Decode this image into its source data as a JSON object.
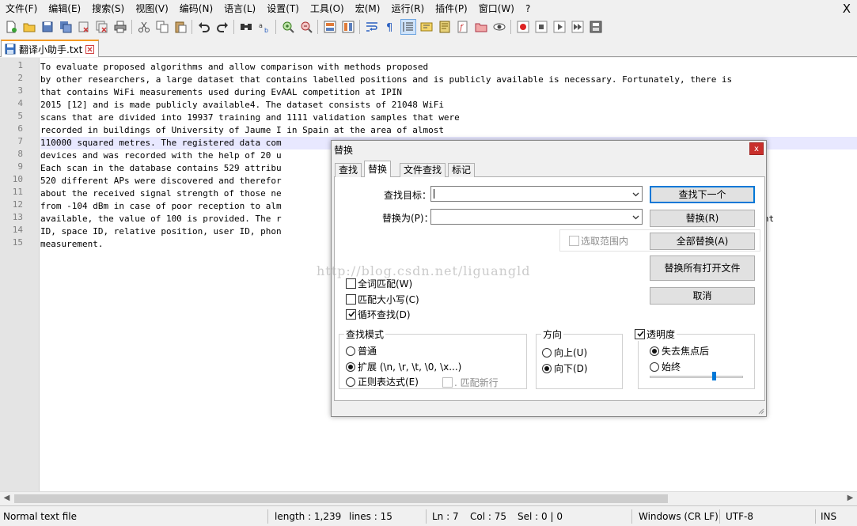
{
  "menu": {
    "items": [
      "文件(F)",
      "编辑(E)",
      "搜索(S)",
      "视图(V)",
      "编码(N)",
      "语言(L)",
      "设置(T)",
      "工具(O)",
      "宏(M)",
      "运行(R)",
      "插件(P)",
      "窗口(W)",
      "?"
    ],
    "close": "X"
  },
  "toolbar_icons": [
    "new-file-icon",
    "open-file-icon",
    "save-icon",
    "save-all-icon",
    "close-icon",
    "close-all-icon",
    "print-icon",
    "cut-icon",
    "copy-icon",
    "paste-icon",
    "undo-icon",
    "redo-icon",
    "find-icon",
    "replace-icon",
    "zoom-in-icon",
    "zoom-out-icon",
    "sync-vertical-icon",
    "sync-horizontal-icon",
    "word-wrap-icon",
    "show-all-chars-icon",
    "indent-guide-icon",
    "user-lang-icon",
    "doc-map-icon",
    "function-list-icon",
    "folder-workspace-icon",
    "monitor-icon",
    "record-macro-icon",
    "stop-macro-icon",
    "play-macro-icon",
    "run-macro-multiple-icon",
    "save-macro-icon"
  ],
  "tab": {
    "label": "翻译小助手.txt"
  },
  "editor": {
    "current_line": 7,
    "lines": [
      "To evaluate proposed algorithms and allow comparison with methods proposed",
      "by other researchers, a large dataset that contains labelled positions and is publicly available is necessary. Fortunately, there is",
      "that contains WiFi measurements used during EvAAL competition at IPIN",
      "2015 [12] and is made publicly available4. The dataset consists of 21048 WiFi",
      "scans that are divided into 19937 training and 1111 validation samples that were",
      "recorded in buildings of University of Jaume I in Spain at the area of almost",
      "110000 squared metres. The registered data com",
      "devices and was recorded with the help of 20 u",
      "Each scan in the database contains 529 attribu",
      "520 different APs were discovered and therefor",
      "about the received signal strength of those ne",
      "from -104 dBm in case of poor reception to alm",
      "available, the value of 100 is provided. The r                                                                             le of measurement",
      "ID, space ID, relative position, user ID, phon",
      "measurement."
    ]
  },
  "statusbar": {
    "file_type": "Normal text file",
    "length": "length : 1,239",
    "lines": "lines : 15",
    "ln": "Ln : 7",
    "col": "Col : 75",
    "sel": "Sel : 0 | 0",
    "eol": "Windows (CR LF)",
    "encoding": "UTF-8",
    "mode": "INS"
  },
  "dialog": {
    "title": "替换",
    "close": "x",
    "tabs": [
      "查找",
      "替换",
      "文件查找",
      "标记"
    ],
    "active_tab": 1,
    "find_label": "查找目标：",
    "find_value": "",
    "replace_label": "替换为(P)：",
    "replace_value": "",
    "in_selection": "选取范围内",
    "buttons": {
      "find_next": "查找下一个",
      "replace": "替换(R)",
      "replace_all": "全部替换(A)",
      "replace_all_open": "替换所有打开文件",
      "cancel": "取消"
    },
    "options": {
      "whole_word": "全词匹配(W)",
      "match_case": "匹配大小写(C)",
      "wrap_around": "循环查找(D)"
    },
    "search_mode": {
      "title": "查找模式",
      "normal": "普通",
      "extended": "扩展 (\\n, \\r, \\t, \\0, \\x...)",
      "regex": "正则表达式(E)",
      "dot_newline": ". 匹配新行",
      "selected": "extended"
    },
    "direction": {
      "title": "方向",
      "up": "向上(U)",
      "down": "向下(D)",
      "selected": "down"
    },
    "transparency": {
      "title": "透明度",
      "on_lose_focus": "失去焦点后",
      "always": "始终",
      "selected": "on_lose_focus",
      "level": 0.7
    },
    "watermark": "http://blog.csdn.net/liguangld"
  }
}
